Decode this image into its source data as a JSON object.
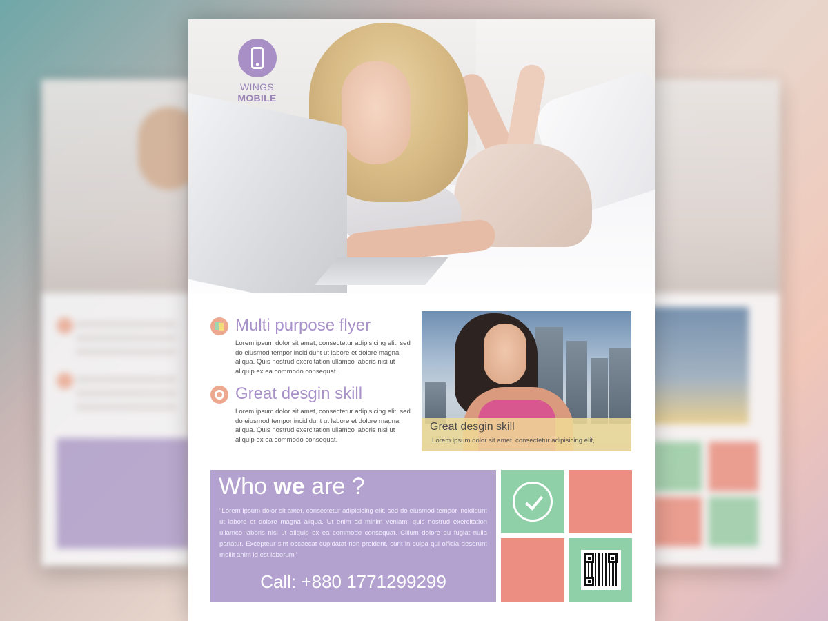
{
  "brand": {
    "name_light": "WINGS",
    "name_bold": "MOBILE",
    "accent": "#a88fc5"
  },
  "features": [
    {
      "title": "Multi purpose flyer",
      "text": "Lorem ipsum dolor sit amet, consectetur adipisicing elit, sed do eiusmod tempor incididunt ut labore et dolore magna aliqua. Quis nostrud exercitation ullamco laboris nisi ut aliquip ex ea commodo consequat.",
      "icon": "color-swatch-icon"
    },
    {
      "title": "Great desgin skill",
      "text": "Lorem ipsum dolor sit amet, consectetur adipisicing elit, sed do eiusmod tempor incididunt ut labore et dolore magna aliqua. Quis nostrud exercitation ullamco laboris nisi ut aliquip ex ea commodo consequat.",
      "icon": "ring-icon"
    }
  ],
  "photo_caption": {
    "title": "Great desgin skill",
    "text": "Lorem ipsum dolor sit amet, consectetur adipisicing elit,"
  },
  "who": {
    "title_pre": "Who ",
    "title_bold": "we",
    "title_post": " are ?",
    "text": "\"Lorem ipsum dolor sit amet, consectetur adipisicing elit, sed do eiusmod tempor incididunt ut labore et dolore magna aliqua. Ut enim ad minim veniam, quis nostrud exercitation ullamco laboris nisi ut aliquip ex ea commodo consequat. Cillum dolore eu fugiat nulla pariatur. Excepteur sint occaecat cupidatat non proident, sunt in culpa qui officia deserunt mollit anim id est laborum\"",
    "call": "Call: +880 1771299299"
  },
  "colors": {
    "purple": "#b3a2cf",
    "green": "#8fd0a8",
    "coral": "#ec8e82",
    "caption_band": "#eeda96"
  }
}
